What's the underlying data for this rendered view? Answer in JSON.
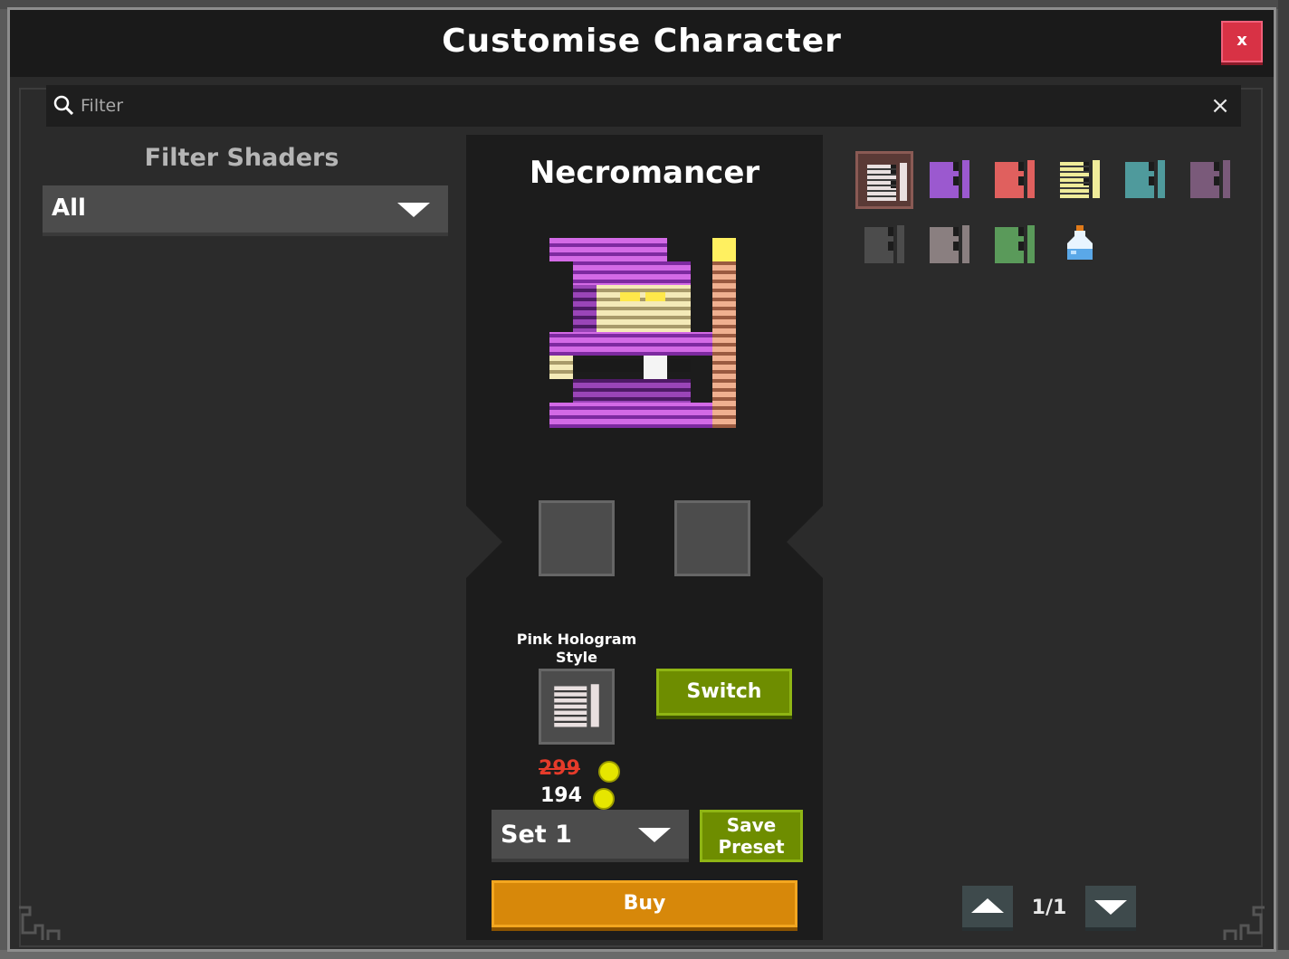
{
  "window": {
    "title": "Customise Character",
    "close_label": "x"
  },
  "search": {
    "placeholder": "Filter"
  },
  "filter_panel": {
    "label": "Filter Shaders",
    "dropdown_value": "All"
  },
  "character": {
    "name": "Necromancer",
    "shader_name": "Pink Hologram Style",
    "switch_label": "Switch",
    "price_old": "299",
    "price_new": "194",
    "preset_value": "Set 1",
    "save_preset_label": "Save Preset",
    "buy_label": "Buy"
  },
  "shaders": [
    {
      "name": "pink-hologram",
      "color": "#e9e0e0",
      "selected": true
    },
    {
      "name": "purple",
      "color": "#9b59cf",
      "selected": false
    },
    {
      "name": "red",
      "color": "#e0605e",
      "selected": false
    },
    {
      "name": "yellow-striped",
      "color": "#f0ec9a",
      "selected": false
    },
    {
      "name": "teal",
      "color": "#4f9a9c",
      "selected": false
    },
    {
      "name": "mauve",
      "color": "#7a5a7a",
      "selected": false
    },
    {
      "name": "dark-grey",
      "color": "#4c4c4c",
      "selected": false
    },
    {
      "name": "grey",
      "color": "#8a7f80",
      "selected": false
    },
    {
      "name": "green",
      "color": "#5a9a5a",
      "selected": false
    },
    {
      "name": "potion",
      "color": "#5aa8e8",
      "selected": false
    }
  ],
  "pagination": {
    "indicator": "1/1"
  }
}
